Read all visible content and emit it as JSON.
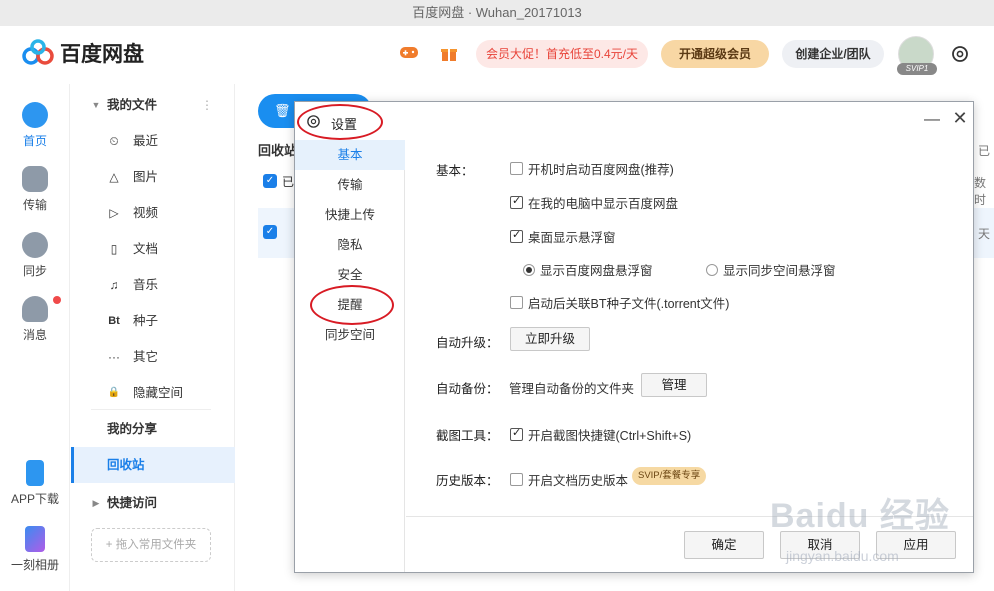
{
  "window": {
    "title": "百度网盘 · Wuhan_20171013"
  },
  "header": {
    "logo_text": "百度网盘",
    "promo": "会员大促！首充低至0.4元/天",
    "svip_button": "开通超级会员",
    "team_button": "创建企业/团队",
    "avatar_badge": "SVIP1",
    "icons": [
      "game-icon",
      "gift-icon",
      "gear-icon"
    ]
  },
  "rail": {
    "items": [
      {
        "label": "首页",
        "icon": "cloud-icon"
      },
      {
        "label": "传输",
        "icon": "transfer-icon"
      },
      {
        "label": "同步",
        "icon": "sync-icon"
      },
      {
        "label": "消息",
        "icon": "message-icon"
      },
      {
        "label": "APP下载",
        "icon": "phone-icon"
      },
      {
        "label": "一刻相册",
        "icon": "album-icon"
      }
    ]
  },
  "tree": {
    "my_files": "我的文件",
    "items": [
      {
        "label": "最近",
        "icon": "⏲"
      },
      {
        "label": "图片",
        "icon": "△"
      },
      {
        "label": "视频",
        "icon": "▷"
      },
      {
        "label": "文档",
        "icon": "▯"
      },
      {
        "label": "音乐",
        "icon": "♫"
      },
      {
        "label": "种子",
        "icon": "Bt"
      },
      {
        "label": "其它",
        "icon": "···"
      },
      {
        "label": "隐藏空间",
        "icon": "🔒"
      }
    ],
    "my_share": "我的分享",
    "recycle": "回收站",
    "quick_access": "快捷访问",
    "drop_hint": "+ 拖入常用文件夹"
  },
  "main": {
    "section": "回收站",
    "select_label": "已",
    "right_label_1": "已",
    "right_label_2": "数时",
    "right_label_3": "天"
  },
  "dialog": {
    "title": "设置",
    "nav": [
      "基本",
      "传输",
      "快捷上传",
      "隐私",
      "安全",
      "提醒",
      "同步空间"
    ],
    "basic": {
      "label": "基本：",
      "autostart": "开机时启动百度网盘(推荐)",
      "show_in_pc": "在我的电脑中显示百度网盘",
      "float_window": "桌面显示悬浮窗",
      "radio_netdisk": "显示百度网盘悬浮窗",
      "radio_sync": "显示同步空间悬浮窗",
      "bt_assoc": "启动后关联BT种子文件(.torrent文件)"
    },
    "upgrade": {
      "label": "自动升级：",
      "button": "立即升级"
    },
    "backup": {
      "label": "自动备份：",
      "text": "管理自动备份的文件夹",
      "button": "管理"
    },
    "screenshot": {
      "label": "截图工具：",
      "option": "开启截图快捷键(Ctrl+Shift+S)"
    },
    "history": {
      "label": "历史版本：",
      "option": "开启文档历史版本",
      "tag": "SVIP/套餐专享"
    },
    "footer": {
      "ok": "确定",
      "cancel": "取消",
      "apply": "应用"
    }
  },
  "watermark": {
    "main": "Baidu 经验",
    "sub": "jingyan.baidu.com"
  },
  "colors": {
    "accent": "#1a7fe8",
    "annotation": "#d81b24",
    "svip": "#f8d7a4"
  }
}
